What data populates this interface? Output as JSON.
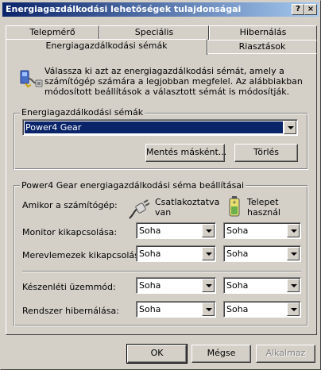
{
  "window": {
    "title": "Energiagazdálkodási lehetőségek tulajdonságai",
    "help_button": "?",
    "close_button": "×"
  },
  "tabs": {
    "back_row": [
      "Telepmérő",
      "Speciális",
      "Hibernálás"
    ],
    "front_row": [
      "Energiagazdálkodási sémák",
      "Riasztások"
    ],
    "active": "Energiagazdálkodási sémák"
  },
  "description": "Válassza ki azt az energiagazdálkodási sémát, amely a számítógép számára a legjobban megfelel. Az alábbiakban módosított beállítások a választott sémát is módosítják.",
  "schemes": {
    "group_label": "Energiagazdálkodási sémák",
    "selected": "Power4 Gear",
    "save_as_label": "Mentés másként...",
    "delete_label": "Törlés"
  },
  "settings": {
    "group_label": "Power4 Gear energiagazdálkodási séma beállításai",
    "when_label": "Amikor a számítógép:",
    "plugged_in_label": "Csatlakoztatva van",
    "battery_label": "Telepet használ",
    "rows": [
      {
        "label": "Monitor kikapcsolása:",
        "plugged": "Soha",
        "battery": "Soha"
      },
      {
        "label": "Merevlemezek kikapcsolása:",
        "plugged": "Soha",
        "battery": "Soha"
      },
      {
        "label": "Készenléti üzemmód:",
        "plugged": "Soha",
        "battery": "Soha"
      },
      {
        "label": "Rendszer hibernálása:",
        "plugged": "Soha",
        "battery": "Soha"
      }
    ]
  },
  "buttons": {
    "ok": "OK",
    "cancel": "Mégse",
    "apply": "Alkalmaz"
  },
  "colors": {
    "titlebar_start": "#0a246a",
    "titlebar_end": "#a6caf0",
    "face": "#d4d0c8",
    "selection": "#0a246a"
  }
}
